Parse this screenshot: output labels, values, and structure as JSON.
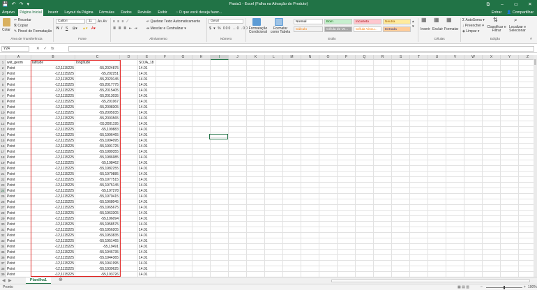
{
  "qat": {
    "save_icon": "💾",
    "undo_icon": "↶",
    "redo_icon": "↷",
    "more_icon": "▾"
  },
  "title": "Pasta1 - Excel (Falha na Ativação do Produto)",
  "window_buttons": {
    "restore": "⧉",
    "minimize": "–",
    "maximize": "▭",
    "close": "✕"
  },
  "tabs": [
    {
      "label": "Arquivo"
    },
    {
      "label": "Página Inicial"
    },
    {
      "label": "Inserir"
    },
    {
      "label": "Layout da Página"
    },
    {
      "label": "Fórmulas"
    },
    {
      "label": "Dados"
    },
    {
      "label": "Revisão"
    },
    {
      "label": "Exibir"
    }
  ],
  "tell_me": "O que você deseja fazer...",
  "signin": "Entrar",
  "share": "Compartilhar",
  "ribbon": {
    "paste": "Colar",
    "cut": "Recortar",
    "copy": "Copiar",
    "format_painter": "Pincel de Formatação",
    "clipboard_group": "Área de Transferência",
    "font_name": "Calibri",
    "font_size": "11",
    "bold": "N",
    "italic": "I",
    "underline": "S",
    "font_group": "Fonte",
    "wrap_text": "Quebrar Texto Automaticamente",
    "merge_center": "Mesclar e Centralizar",
    "alignment_group": "Alinhamento",
    "number_format": "Geral",
    "number_group": "Número",
    "conditional": "Formatação Condicional",
    "format_table": "Formatar como Tabela",
    "styles_group": "Estilo",
    "styles": [
      {
        "label": "Normal",
        "bg": "#ffffff",
        "fg": "#000000"
      },
      {
        "label": "Bom",
        "bg": "#c6efce",
        "fg": "#006100"
      },
      {
        "label": "Incorreto",
        "bg": "#ffc7ce",
        "fg": "#9c0006"
      },
      {
        "label": "Neutra",
        "bg": "#ffeb9c",
        "fg": "#9c5700"
      },
      {
        "label": "Cálculo",
        "bg": "#f2f2f2",
        "fg": "#fa7d00"
      },
      {
        "label": "Célula de Ve...",
        "bg": "#a5a5a5",
        "fg": "#ffffff"
      },
      {
        "label": "Célula Vincu...",
        "bg": "#ffffff",
        "fg": "#fa7d00"
      },
      {
        "label": "Entrada",
        "bg": "#ffcc99",
        "fg": "#3f3f76"
      }
    ],
    "insert": "Inserir",
    "delete": "Excluir",
    "format": "Formatar",
    "cells_group": "Células",
    "autosum": "AutoSoma",
    "fill": "Preencher",
    "clear": "Limpar",
    "sort_filter": "Classificar e Filtrar",
    "find_select": "Localizar e Selecionar",
    "editing_group": "Edição"
  },
  "name_box": "Y24",
  "fx": "fx",
  "columns": [
    "A",
    "B",
    "C",
    "D",
    "E",
    "F",
    "G",
    "H",
    "I",
    "J",
    "K",
    "L",
    "M",
    "N",
    "O",
    "P",
    "Q",
    "R",
    "S",
    "T",
    "U",
    "V",
    "W",
    "X",
    "Y",
    "Z"
  ],
  "selected_col": "I",
  "selected_row": 24,
  "sheet": {
    "headers": {
      "a": "wkt_geom",
      "b": "latitude",
      "c": "longitude",
      "e": "SOJA_18"
    },
    "geom": "Point",
    "lat": "-12,1115225",
    "soja": "14.01",
    "longitudes": [
      "-55,2024875",
      "-55,202251",
      "-55,2020145",
      "-55,2017775",
      "-55,2015405",
      "-55,2013035",
      "-55,201067",
      "-55,2008305",
      "-55,2005935",
      "-55,2003565",
      "-55,2001195",
      "-55,199883",
      "-55,1996465",
      "-55,1994095",
      "-55,1991725",
      "-55,1989355",
      "-55,1986985",
      "-55,198462",
      "-55,1982255",
      "-55,1979885",
      "-55,1977515",
      "-55,1975145",
      "-55,197278",
      "-55,1970415",
      "-55,1968045",
      "-55,1965675",
      "-55,1963305",
      "-55,196094",
      "-55,1958575",
      "-55,1956205",
      "-55,1953835",
      "-55,1951465",
      "-55,19491",
      "-55,1946735",
      "-55,1944365",
      "-55,1941995",
      "-55,1939625",
      "-55,193726"
    ]
  },
  "sheet_tab": "Planilha1",
  "add_sheet": "⊕",
  "status_left": "Pronto",
  "zoom": "100%"
}
